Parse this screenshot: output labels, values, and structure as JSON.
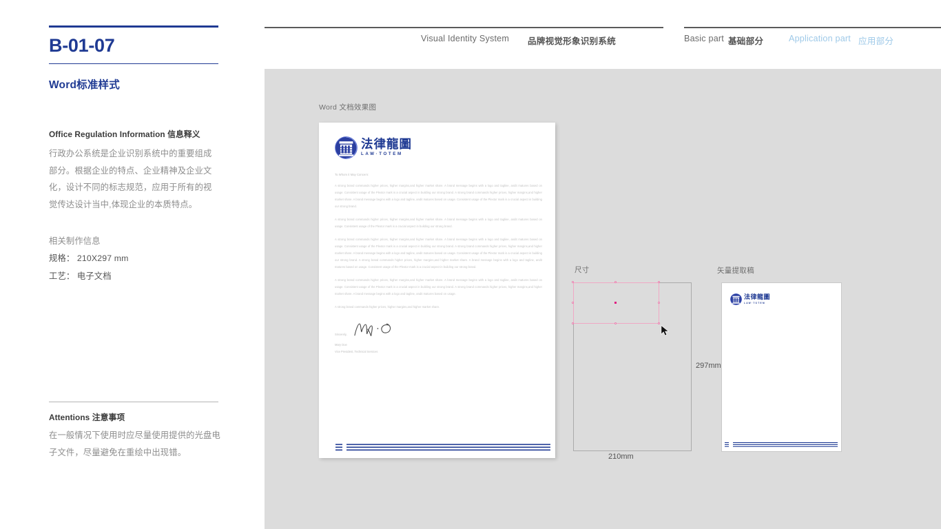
{
  "sidebar": {
    "code": "B-01-07",
    "subtitle": "Word标准样式",
    "section_head": "Office Regulation Information  信息释义",
    "body_text": "行政办公系统是企业识别系统中的重要组成部分。根据企业的特点、企业精神及企业文化，设计不同的标志规范，应用于所有的视觉传达设计当中,体现企业的本质特点。",
    "spec_label": "相关制作信息",
    "spec_size": "规格： 210X297 mm",
    "spec_process": "工艺： 电子文档",
    "attentions_head": "Attentions 注意事项",
    "attentions_body": "在一般情况下使用时应尽量使用提供的光盘电子文件，尽量避免在重绘中出现错。"
  },
  "header": {
    "visual_identity_en": "Visual Identity System",
    "visual_identity_zh": "品牌视觉形象识别系统",
    "basic_part_en": "Basic part",
    "basic_part_zh": "基础部分",
    "application_part_en": "Application part",
    "application_part_zh": "应用部分"
  },
  "canvas": {
    "caption_word": "Word 文档效果图",
    "caption_size": "尺寸",
    "caption_vector": "矢量提取稿"
  },
  "document": {
    "logo_cn": "法律龍圖",
    "logo_en": "LAW·TOTEM",
    "salutation": "To Whom it May Concern:",
    "paragraph_1": "A strong brand commands higher prices, higher margins,and higher market share. A brand message begins with a logo and tagline, andit matures based on usage. Consistent usage of the Plextor mark is a crucial aspect in building our strong brand. A strong brand commands higher prices, higher margins,and higher market share. A brand message begins with a logo and tagline, andit matures based on usage. Consistent usage of the Plextor mark is a crucial aspect in building our strong brand.",
    "paragraph_2": "A strong brand commands higher prices, higher margins,and higher market share. A brand message begins with a logo and tagline, andit matures based on usage. Consistent usage of the Plextor mark is a crucial aspect in building our strong brand.",
    "paragraph_3": "A strong brand commands higher prices, higher margins,and higher market share. A brand message begins with a logo and tagline, andit matures based on usage. Consistent usage of the Plextor mark is a crucial aspect in building our strong brand. A strong brand commands higher prices, higher margins,and higher market share. A brand message begins with a logo and tagline, andit matures based on usage. Consistent usage of the Plextor mark is a crucial aspect in building our strong brand. A strong brand commands higher prices, higher margins,and higher market share. A brand message begins with a logo and tagline, andit matures based on usage. Consistent usage of the Plextor mark is a crucial aspect in building our strong brand.",
    "paragraph_4": "A strong brand commands higher prices, higher margins,and higher market share. A brand message begins with a logo and tagline, andit matures based on usage. Consistent usage of the Plextor mark is a crucial aspect in building our strong brand. A strong brand commands higher prices, higher margins,and higher market share. A brand message begins with a logo and tagline, andit matures based on usage.",
    "paragraph_5": "A strong brand commands higher prices, higher margins,and higher market share.",
    "sincerely": "Sincerely,",
    "signer_name": "Mary Doe",
    "signer_title": "Vice President, Technical Services"
  },
  "dimensions": {
    "height_label": "297mm",
    "width_label": "210mm"
  },
  "colors": {
    "brand_blue": "#1f3a93",
    "accent_light_blue": "#9ec9e8",
    "canvas_gray": "#dcdcdc",
    "selection_pink": "#f0a8c4",
    "center_handle": "#e0197f"
  }
}
